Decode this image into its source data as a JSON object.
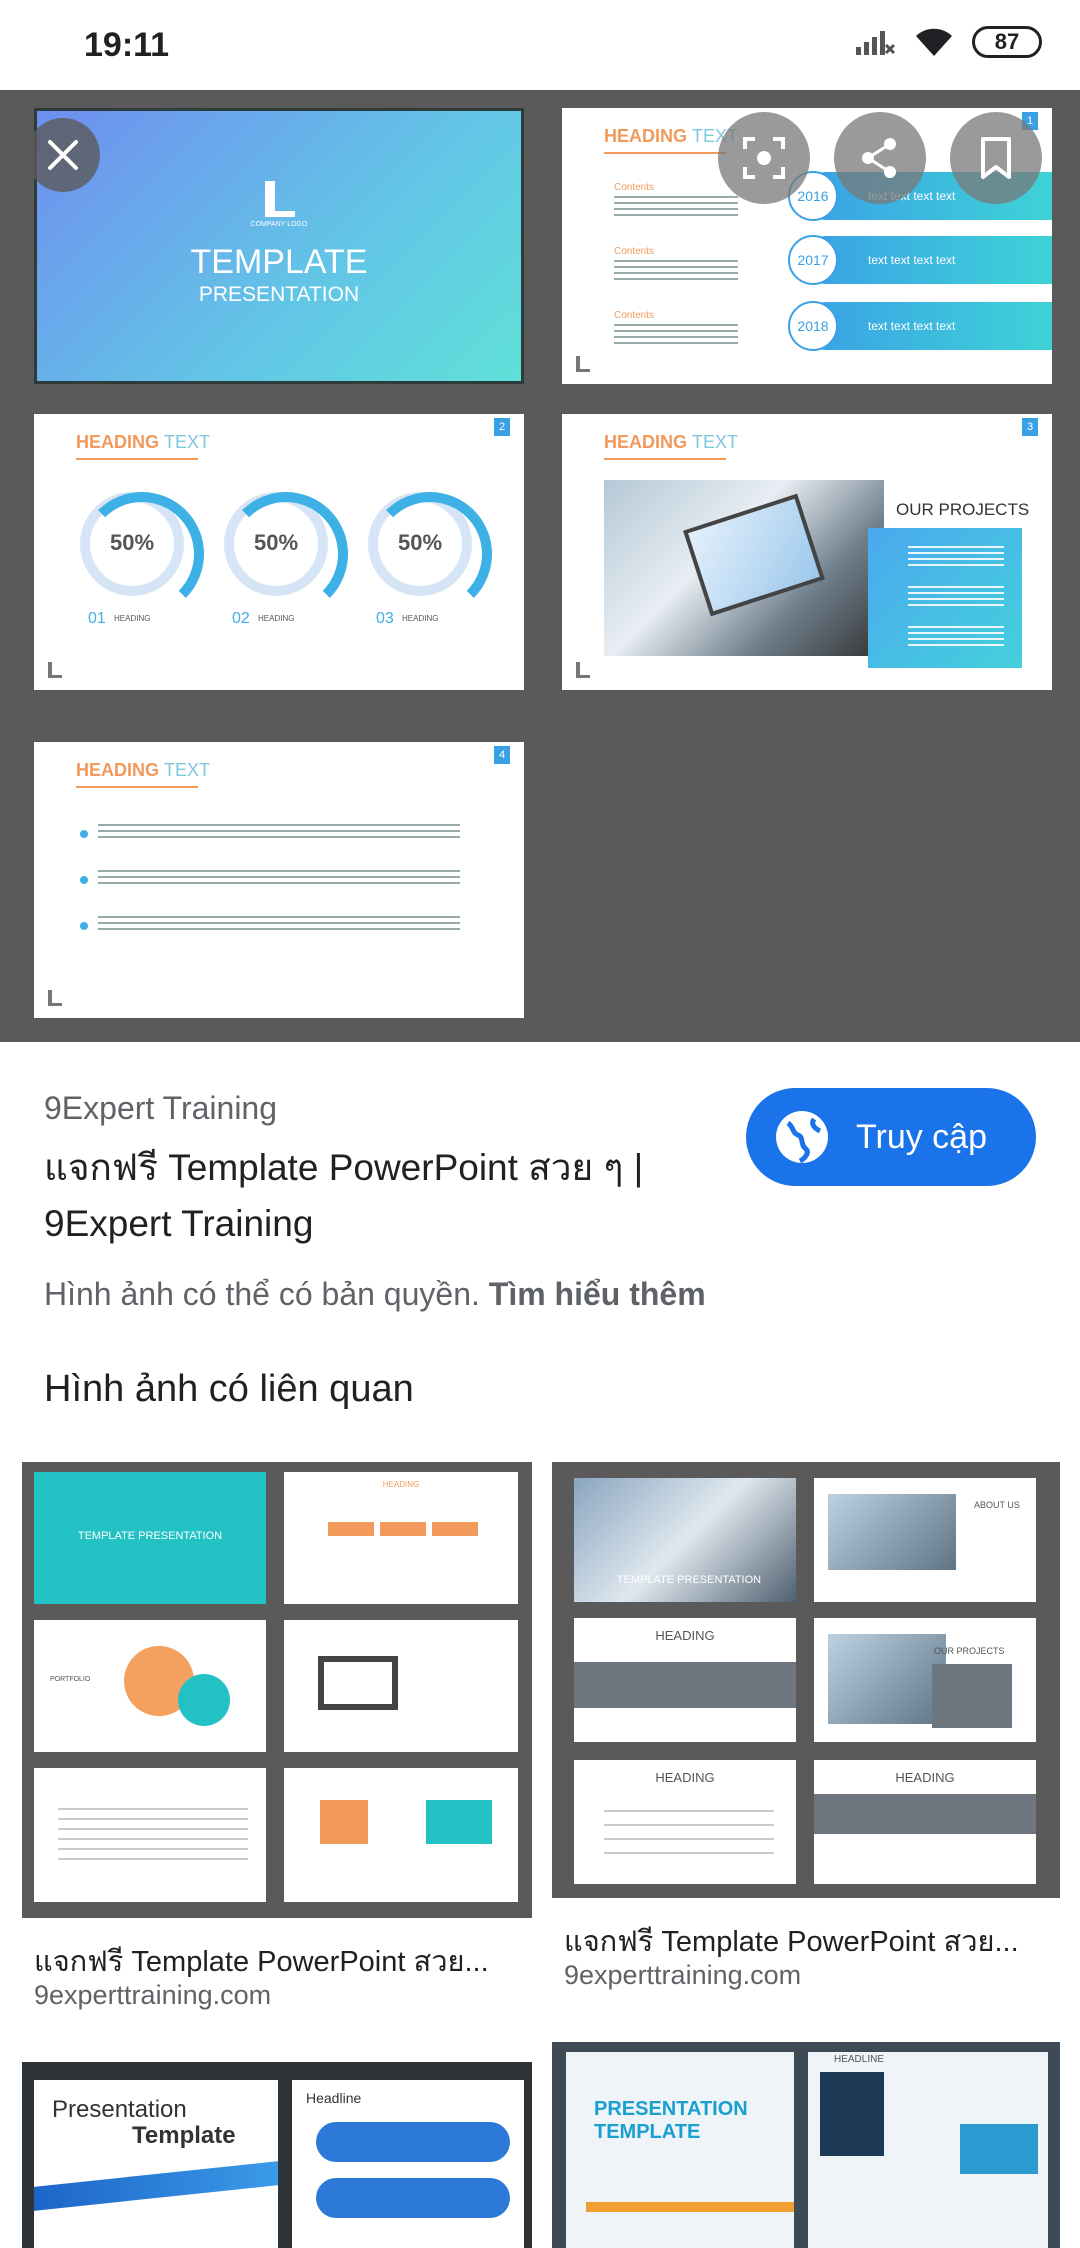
{
  "status_bar": {
    "time": "19:11",
    "battery": "87",
    "icons": [
      "signal-icon",
      "wifi-icon",
      "battery-icon"
    ]
  },
  "preview": {
    "slides": {
      "cover_title": "TEMPLATE",
      "cover_subtitle": "PRESENTATION",
      "cover_logo_text": "COMPANY LOGO",
      "heading_main": "HEADING",
      "heading_light": "TEXT",
      "percent": "50%",
      "items": [
        "01",
        "02",
        "03"
      ],
      "item_label": "HEADING",
      "contents_label": "Contents",
      "years": [
        "2016",
        "2017",
        "2018"
      ],
      "bar_text": "text text text text",
      "projects_title": "OUR PROJECTS",
      "slide_numbers": [
        "1",
        "2",
        "3",
        "4"
      ]
    },
    "overlay_icons": [
      "close-icon",
      "lens-icon",
      "share-icon",
      "bookmark-icon"
    ]
  },
  "result": {
    "source": "9Expert Training",
    "title": "แจกฟรี Template PowerPoint สวย ๆ | 9Expert Training",
    "visit_label": "Truy cập",
    "copyright_text": "Hình ảnh có thể có bản quyền.",
    "learn_more": "Tìm hiểu thêm"
  },
  "related": {
    "title": "Hình ảnh có liên quan",
    "cards": [
      {
        "caption": "แจกฟรี Template PowerPoint สวย...",
        "domain": "9experttraining.com",
        "thumb_text": [
          "TEMPLATE PRESENTATION",
          "HEADING",
          "PORTFOLIO"
        ]
      },
      {
        "caption": "แจกฟรี Template PowerPoint สวย...",
        "domain": "9experttraining.com",
        "thumb_text": [
          "TEMPLATE PRESENTATION",
          "HEADING",
          "OUR PROJECTS",
          "ABOUT US"
        ]
      },
      {
        "thumb_text": [
          "Presentation",
          "Template",
          "Headline"
        ]
      },
      {
        "thumb_text": [
          "PRESENTATION TEMPLATE",
          "HEADLINE"
        ]
      }
    ]
  }
}
